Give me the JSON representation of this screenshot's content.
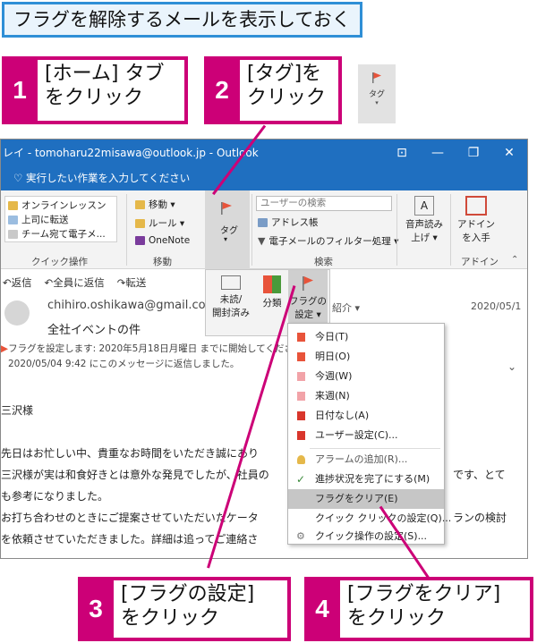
{
  "page_title": "フラグを解除するメールを表示しておく",
  "steps": [
    {
      "num": "1",
      "line1": "[ホーム] タブ",
      "line2": "をクリック"
    },
    {
      "num": "2",
      "line1": "[タグ]を",
      "line2": "クリック"
    },
    {
      "num": "3",
      "line1": "[フラグの設定]",
      "line2": "をクリック"
    },
    {
      "num": "4",
      "line1": "[フラグをクリア]",
      "line2": "をクリック"
    }
  ],
  "small_tag_label": "タグ",
  "window": {
    "title": "レイ - tomoharu22misawa@outlook.jp  -  Outlook",
    "controls": [
      "⊡",
      "—",
      "❐",
      "✕"
    ],
    "tell_me": "実行したい作業を入力してください"
  },
  "ribbon": {
    "quick_steps": [
      "オンラインレッスン",
      "上司に転送",
      "チーム宛て電子メ..."
    ],
    "quick_steps_label": "クイック操作",
    "move_items": [
      "移動 ▾",
      "ルール ▾",
      "OneNote"
    ],
    "move_label": "移動",
    "tags_label": "タグ",
    "search_placeholder": "ユーザーの検索",
    "address_book": "アドレス帳",
    "filter_email": "電子メールのフィルター処理 ▾",
    "search_label": "検索",
    "read_aloud": [
      "音声読み",
      "上げ ▾"
    ],
    "addin": [
      "アドイン",
      "を入手"
    ],
    "addin_label": "アドイン"
  },
  "tag_panel": {
    "unread": [
      "未読/",
      "開封済み"
    ],
    "categorize": "分類",
    "followup": [
      "フラグの",
      "設定 ▾"
    ]
  },
  "mail": {
    "actions": [
      "返信",
      "全員に返信",
      "転送"
    ],
    "from": "chihiro.oshikawa@gmail.co",
    "introduce": "紹介 ▾",
    "date": "2020/05/1",
    "subject": "全社イベントの件",
    "flag_info": "フラグを設定します:  2020年5月18日月曜日 までに開始してください。",
    "reply_info": "2020/05/04 9:42 にこのメッセージに返信しました。",
    "body": [
      "三沢様",
      "先日はお忙しい中、貴重なお時間をいただき誠にあり",
      "三沢様が実は和食好きとは意外な発見でしたが、社員の",
      "も参考になりました。",
      "お打ち合わせのときにご提案させていただいたケータ",
      "を依頼させていただきました。詳細は追ってご連絡さ"
    ],
    "body_right_1": "です、とて",
    "body_right_2": "ランの検討"
  },
  "flag_menu": {
    "items": [
      {
        "label": "今日(T)",
        "color": "#e8533a"
      },
      {
        "label": "明日(O)",
        "color": "#e8533a"
      },
      {
        "label": "今週(W)",
        "color": "#f2a3a8"
      },
      {
        "label": "来週(N)",
        "color": "#f2a3a8"
      },
      {
        "label": "日付なし(A)",
        "color": "#d9362c"
      },
      {
        "label": "ユーザー設定(C)...",
        "color": "#d9362c"
      }
    ],
    "alarm": "アラームの追加(R)...",
    "mark_complete": "進捗状況を完了にする(M)",
    "clear_flag": "フラグをクリア(E)",
    "quick_click": "クイック クリックの設定(Q)...",
    "quick_actions": "クイック操作の設定(S)..."
  },
  "colors": {
    "accent": "#cc0077",
    "title_border": "#2f8fd6",
    "outlook_blue": "#1f6fc0"
  }
}
